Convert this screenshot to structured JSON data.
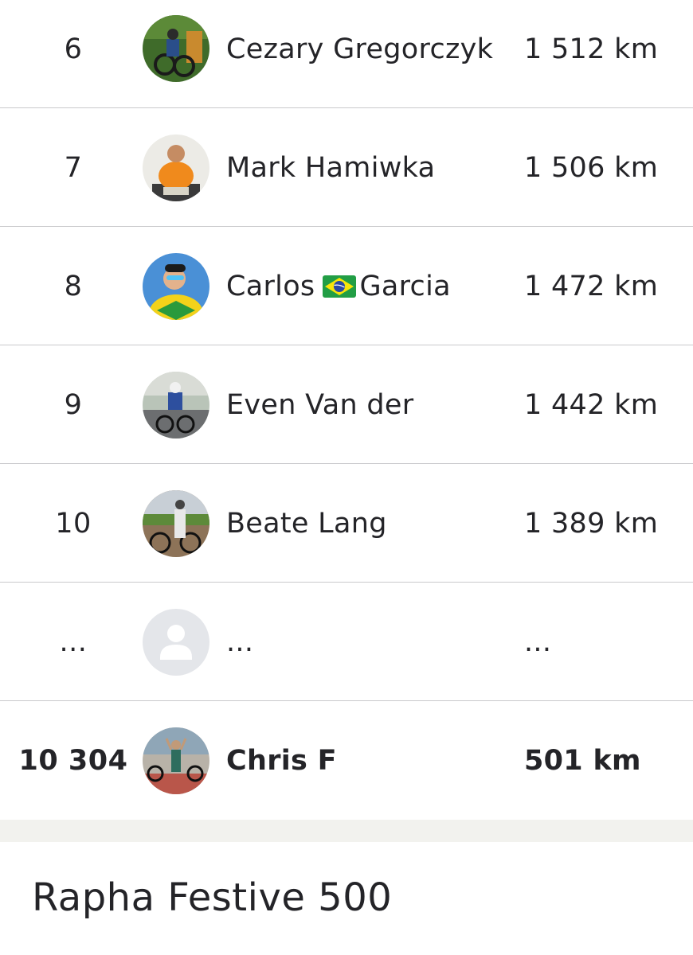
{
  "leaderboard": {
    "rows": [
      {
        "rank": "6",
        "name": "Cezary Gregorczyk",
        "distance": "1 512 km",
        "avatar": "cyclist-forest-photo"
      },
      {
        "rank": "7",
        "name": "Mark Hamiwka",
        "distance": "1 506 km",
        "avatar": "man-orange-shirt-photo"
      },
      {
        "rank": "8",
        "name_first": "Carlos ",
        "flag": "brazil-flag-icon",
        "name_last": "Garcia",
        "distance": "1 472 km",
        "avatar": "cyclist-brazil-kit-photo"
      },
      {
        "rank": "9",
        "name": "Even Van der",
        "distance": "1 442 km",
        "avatar": "cyclist-road-photo"
      },
      {
        "rank": "10",
        "name": "Beate Lang",
        "distance": "1 389 km",
        "avatar": "cyclist-field-photo"
      },
      {
        "rank": "...",
        "name": "...",
        "distance": "...",
        "avatar": "user-placeholder-icon"
      },
      {
        "rank": "10 304",
        "name": "Chris F",
        "distance": "501 km",
        "avatar": "cyclists-group-photo",
        "current_user": true
      }
    ]
  },
  "footer": {
    "title": "Rapha Festive 500"
  },
  "colors": {
    "text": "#242428",
    "divider": "#c9c9cc",
    "band": "#f2f2ee",
    "placeholder_bg": "#e4e6ea",
    "placeholder_fg": "#ffffff"
  }
}
